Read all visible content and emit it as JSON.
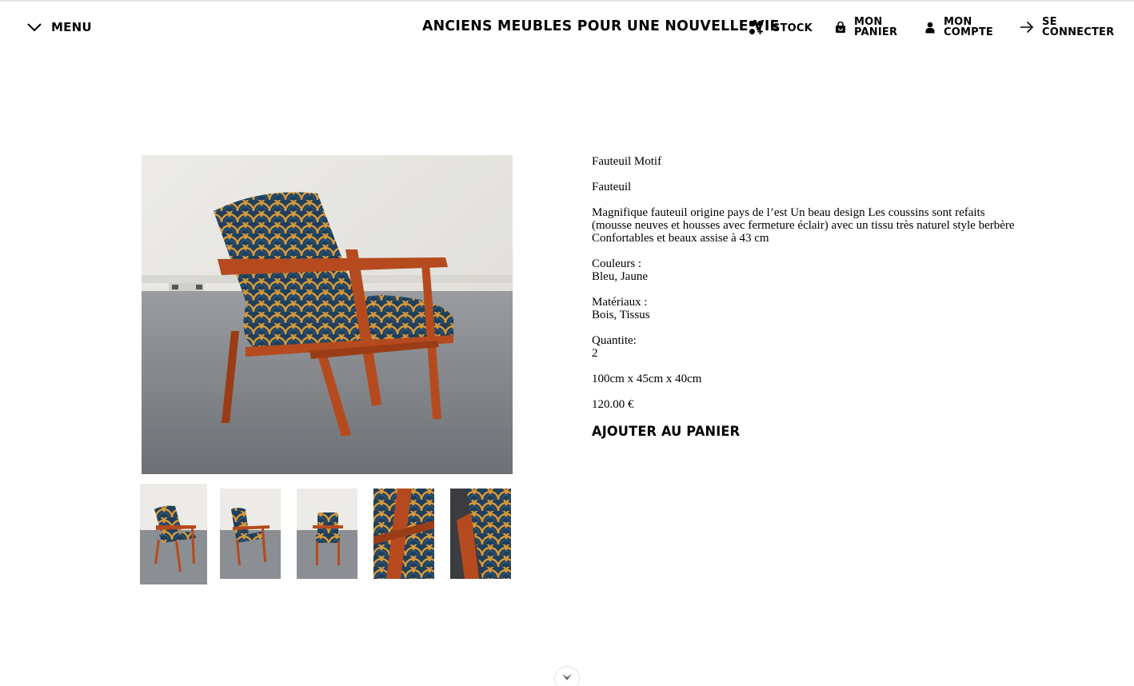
{
  "header": {
    "menu_label": "MENU",
    "site_title": "ANCIENS MEUBLES POUR UNE NOUVELLE VIE",
    "nav": {
      "stock": "STOCK",
      "cart_line1": "MON",
      "cart_line2": "PANIER",
      "account_line1": "MON",
      "account_line2": "COMPTE",
      "login_line1": "SE",
      "login_line2": "CONNECTER"
    }
  },
  "product": {
    "name": "Fauteuil Motif",
    "category": "Fauteuil",
    "description": "Magnifique fauteuil origine pays de l’est Un beau design Les coussins sont refaits (mousse neuves et housses avec fermeture éclair) avec un tissu très naturel style berbère Confortables et beaux assise à 43 cm",
    "colors_label": "Couleurs :",
    "colors_value": "Bleu, Jaune",
    "materials_label": "Matériaux :",
    "materials_value": "Bois, Tissus",
    "quantity_label": "Quantite:",
    "quantity_value": "2",
    "dimensions": "100cm x 45cm x 40cm",
    "price": "120.00 €",
    "add_to_cart": "AJOUTER AU PANIER"
  },
  "gallery": {
    "thumbnail_count": 5,
    "active_index": 0
  },
  "colors": {
    "wood": "#b54a1f",
    "fabric_blue": "#1f3f5c",
    "fabric_yellow": "#d99a3a",
    "wall": "#ecebe7",
    "floor": "#7f8287"
  },
  "icons": {
    "menu": "chevron-down-icon",
    "stock": "grid-plus-icon",
    "cart": "shopping-bag-icon",
    "account": "user-icon",
    "login": "arrow-right-icon",
    "scroll": "chevron-down-icon"
  }
}
